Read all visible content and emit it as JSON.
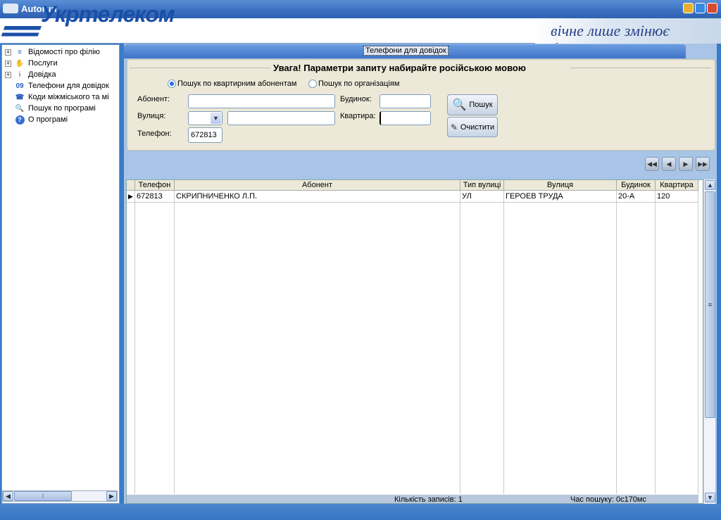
{
  "window": {
    "title": "Autorun"
  },
  "banner": {
    "logo": "Укртелеком",
    "slogan": "вічне лише змінює форму..."
  },
  "tree": {
    "items": [
      {
        "label": "Відомості про філію",
        "icon": "company-logo-icon",
        "expandable": true
      },
      {
        "label": "Послуги",
        "icon": "services-icon",
        "expandable": true
      },
      {
        "label": "Довідка",
        "icon": "info-icon",
        "expandable": true
      },
      {
        "label": "Телефони для довідок",
        "icon": "09-icon",
        "icon_text": "09",
        "expandable": false
      },
      {
        "label": "Коди міжміського та мі",
        "icon": "phone-icon",
        "expandable": false
      },
      {
        "label": "Пошук по програмі",
        "icon": "search-icon",
        "expandable": false
      },
      {
        "label": "О програмі",
        "icon": "help-icon",
        "expandable": false
      }
    ]
  },
  "tab": {
    "label": "Телефони для довідок"
  },
  "form": {
    "warning": "Увага! Параметри запиту набирайте російською мовою",
    "radio_residential": "Пошук по квартирним абонентам",
    "radio_org": "Пошук по організаціям",
    "subscriber_label": "Абонент:",
    "subscriber_value": "",
    "street_label": "Вулиця:",
    "street_type_value": "",
    "street_value": "",
    "phone_label": "Телефон:",
    "phone_value": "672813",
    "house_label": "Будинок:",
    "house_value": "",
    "apartment_label": "Квартира:",
    "apartment_value": "",
    "search_button": "Пошук",
    "clear_button": "Очистити"
  },
  "grid": {
    "columns": [
      "Телефон",
      "Абонент",
      "Тип вулиці",
      "Вулиця",
      "Будинок",
      "Квартира"
    ],
    "rows": [
      [
        "672813",
        "СКРИПНИЧЕНКО Л.П.",
        "УЛ",
        "ГЕРОЕВ ТРУДА",
        "20-А",
        "120"
      ]
    ],
    "footer_count": "Кількість записів: 1",
    "footer_time": "Час пошуку: 0с170мс"
  },
  "colors": {
    "titlebar": "#3a6fc0",
    "form_bg": "#ece9d8",
    "panel_bg": "#a8c4e6"
  }
}
